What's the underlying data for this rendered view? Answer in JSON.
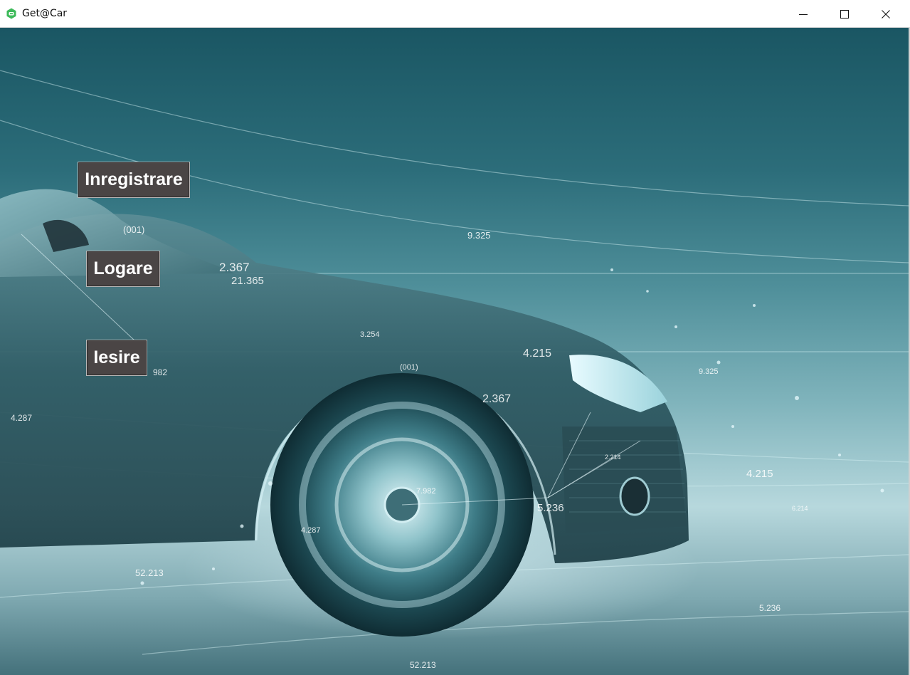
{
  "window": {
    "title": "Get@Car",
    "controls": {
      "minimize_icon": "minimize-icon",
      "maximize_icon": "maximize-icon",
      "close_icon": "close-icon"
    }
  },
  "menu": {
    "register_label": "Inregistrare",
    "login_label": "Logare",
    "exit_label": "Iesire"
  },
  "background": {
    "overlay_numbers": [
      "(001)",
      "9.325",
      "2.367",
      "21.365",
      "3.254",
      "4.215",
      "(001)",
      "9.325",
      "2.367",
      "982",
      "4.287",
      "2.214",
      "7.982",
      "5.236",
      "4.215",
      "6.214",
      "4.287",
      "52.213",
      "5.236",
      "52.213"
    ]
  },
  "colors": {
    "button_bg": "#4a4545",
    "button_text": "#ffffff",
    "scene_dark": "#1a5663",
    "scene_light": "#b7d8dd",
    "app_icon": "#3dba5a"
  }
}
